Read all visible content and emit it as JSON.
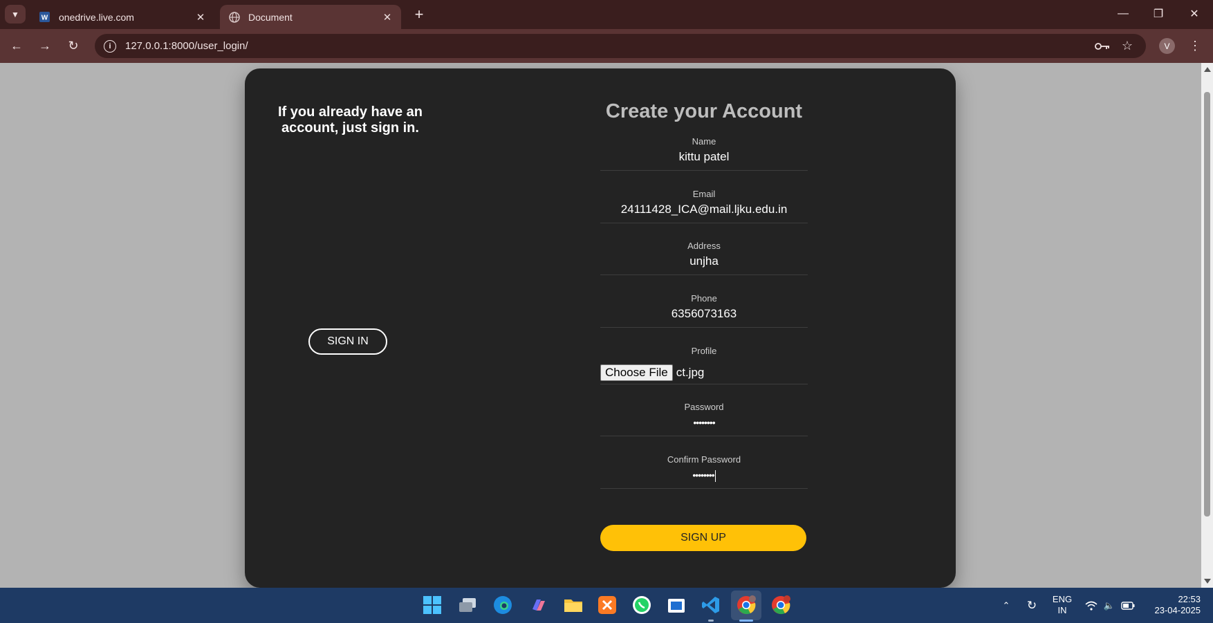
{
  "browser": {
    "tabs": [
      {
        "title": "onedrive.live.com",
        "icon": "word-icon"
      },
      {
        "title": "Document",
        "icon": "globe-icon"
      }
    ],
    "url": "127.0.0.1:8000/user_login/",
    "profile_initial": "V"
  },
  "page": {
    "left_heading": "If you already have an account, just sign in.",
    "signin_label": "SIGN IN",
    "form_title": "Create your Account",
    "fields": [
      {
        "label": "Name",
        "value": "kittu patel"
      },
      {
        "label": "Email",
        "value": "24111428_ICA@mail.ljku.edu.in"
      },
      {
        "label": "Address",
        "value": "unjha"
      },
      {
        "label": "Phone",
        "value": "6356073163"
      },
      {
        "label": "Profile",
        "button": "Choose File",
        "value": "ct.jpg"
      },
      {
        "label": "Password",
        "value": "••••••••"
      },
      {
        "label": "Confirm Password",
        "value": "••••••••"
      }
    ],
    "signup_label": "SIGN UP",
    "colors": {
      "card": "#232323",
      "accent": "#ffc107",
      "page_bg": "#b3b3b3"
    }
  },
  "taskbar": {
    "apps": [
      "windows-start-icon",
      "task-view-icon",
      "edge-icon",
      "copilot-icon",
      "file-explorer-icon",
      "xampp-icon",
      "whatsapp-icon",
      "store-icon",
      "vscode-icon",
      "chrome-icon",
      "chrome-icon"
    ],
    "language": {
      "line1": "ENG",
      "line2": "IN"
    },
    "time": "22:53",
    "date": "23-04-2025"
  }
}
